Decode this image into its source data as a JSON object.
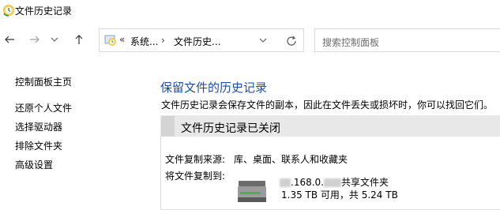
{
  "window": {
    "title": "文件历史记录"
  },
  "nav": {
    "back_icon": "arrow-left-icon",
    "forward_icon": "arrow-right-icon",
    "recent_icon": "chevron-down-icon",
    "up_icon": "arrow-up-icon",
    "address": {
      "overflow": "«",
      "segment1": "系统...",
      "separator": "›",
      "segment2": "文件历史...",
      "dropdown_icon": "chevron-down-icon",
      "refresh_icon": "refresh-icon"
    },
    "search": {
      "placeholder": "搜索控制面板"
    }
  },
  "sidebar": {
    "items": [
      {
        "label": "控制面板主页"
      },
      {
        "label": "还原个人文件"
      },
      {
        "label": "选择驱动器"
      },
      {
        "label": "排除文件夹"
      },
      {
        "label": "高级设置"
      }
    ]
  },
  "main": {
    "heading": "保留文件的历史记录",
    "description": "文件历史记录会保存文件的副本，因此在文件丢失或损坏时，你可以找回它们。",
    "status_title": "文件历史记录已关闭",
    "source_label": "文件复制来源:",
    "source_value": "库、桌面、联系人和收藏夹",
    "dest_label": "将文件复制到:",
    "dest_name_visible": ".168.0.",
    "dest_name_suffix": "共享文件夹",
    "dest_space": "1.35 TB 可用，共 5.24 TB"
  },
  "colors": {
    "heading": "#1f4e9c",
    "status_strip": "#e8e8e8",
    "border": "#d9d9d9"
  }
}
